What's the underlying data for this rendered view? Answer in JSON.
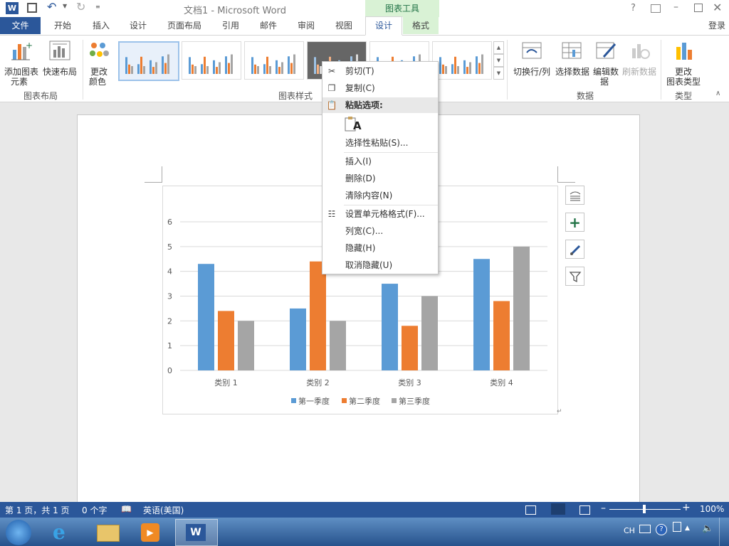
{
  "window": {
    "title": "文档1 - Microsoft Word",
    "context_tab_group": "图表工具",
    "help": "?",
    "login": "登录"
  },
  "tabs": [
    {
      "label": "文件"
    },
    {
      "label": "开始"
    },
    {
      "label": "插入"
    },
    {
      "label": "设计"
    },
    {
      "label": "页面布局"
    },
    {
      "label": "引用"
    },
    {
      "label": "邮件"
    },
    {
      "label": "审阅"
    },
    {
      "label": "视图"
    },
    {
      "label": "设计"
    },
    {
      "label": "格式"
    }
  ],
  "ribbon": {
    "add_element_1": "添加图表",
    "add_element_2": "元素",
    "quick_layout": "快速布局",
    "change_color_1": "更改",
    "change_color_2": "颜色",
    "switch_row_col": "切换行/列",
    "select_data": "选择数据",
    "edit_data_1": "编辑数",
    "edit_data_2": "据",
    "refresh_data": "刷新数据",
    "change_type_1": "更改",
    "change_type_2": "图表类型",
    "groups": {
      "chart_layout": "图表布局",
      "chart_styles": "图表样式",
      "data": "数据",
      "type": "类型"
    }
  },
  "context_menu": {
    "items": [
      {
        "label": "剪切(T)",
        "icon": "scissors-icon"
      },
      {
        "label": "复制(C)",
        "icon": "copy-icon"
      },
      {
        "label": "粘贴选项:",
        "icon": "paste-icon"
      },
      {
        "label": "选择性粘贴(S)...",
        "icon": ""
      },
      {
        "label": "插入(I)",
        "icon": ""
      },
      {
        "label": "删除(D)",
        "icon": ""
      },
      {
        "label": "清除内容(N)",
        "icon": ""
      },
      {
        "label": "设置单元格格式(F)...",
        "icon": "format-cells-icon"
      },
      {
        "label": "列宽(C)...",
        "icon": ""
      },
      {
        "label": "隐藏(H)",
        "icon": ""
      },
      {
        "label": "取消隐藏(U)",
        "icon": ""
      }
    ],
    "paste_text_glyph": "A"
  },
  "chart_data": {
    "type": "bar",
    "categories": [
      "类别 1",
      "类别 2",
      "类别 3",
      "类别 4"
    ],
    "series": [
      {
        "name": "第一季度",
        "values": [
          4.3,
          2.5,
          3.5,
          4.5
        ]
      },
      {
        "name": "第二季度",
        "values": [
          2.4,
          4.4,
          1.8,
          2.8
        ]
      },
      {
        "name": "第三季度",
        "values": [
          2,
          2,
          3,
          5
        ]
      }
    ],
    "colors": [
      "#5b9bd5",
      "#ed7d31",
      "#a5a5a5"
    ],
    "yticks": [
      "0",
      "1",
      "2",
      "3",
      "4",
      "5",
      "6"
    ],
    "ylim": [
      0,
      6
    ],
    "grid": true,
    "legend_position": "bottom"
  },
  "status": {
    "page": "第 1 页，共 1 页",
    "words": "0 个字",
    "language": "英语(美国)",
    "zoom": "100%"
  },
  "taskbar": {
    "ime": "CH"
  },
  "colors": {
    "accent": "#2b579a",
    "context_tab": "#d9f2d5",
    "context_tab_text": "#217346"
  }
}
